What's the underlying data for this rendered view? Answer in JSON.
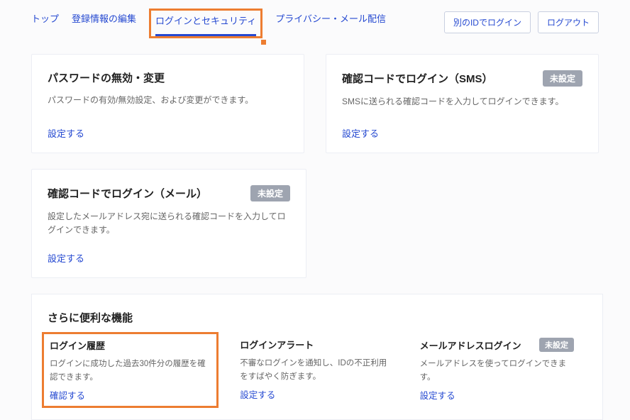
{
  "tabs": {
    "top": "トップ",
    "edit": "登録情報の編集",
    "login": "ログインとセキュリティ",
    "privacy": "プライバシー・メール配信"
  },
  "header": {
    "other_id_login": "別のIDでログイン",
    "logout": "ログアウト"
  },
  "cards": {
    "password": {
      "title": "パスワードの無効・変更",
      "desc": "パスワードの有効/無効設定、および変更ができます。",
      "link": "設定する"
    },
    "sms": {
      "title": "確認コードでログイン（SMS）",
      "badge": "未設定",
      "desc": "SMSに送られる確認コードを入力してログインできます。",
      "link": "設定する"
    },
    "mail": {
      "title": "確認コードでログイン（メール）",
      "badge": "未設定",
      "desc": "設定したメールアドレス宛に送られる確認コードを入力してログインできます。",
      "link": "設定する"
    }
  },
  "section": {
    "title": "さらに便利な機能",
    "features": {
      "history": {
        "title": "ログイン履歴",
        "desc": "ログインに成功した過去30件分の履歴を確認できます。",
        "link": "確認する"
      },
      "alert": {
        "title": "ログインアラート",
        "desc": "不審なログインを通知し、IDの不正利用をすばやく防ぎます。",
        "link": "設定する"
      },
      "email_login": {
        "title": "メールアドレスログイン",
        "badge": "未設定",
        "desc": "メールアドレスを使ってログインできます。",
        "link": "設定する"
      }
    }
  }
}
